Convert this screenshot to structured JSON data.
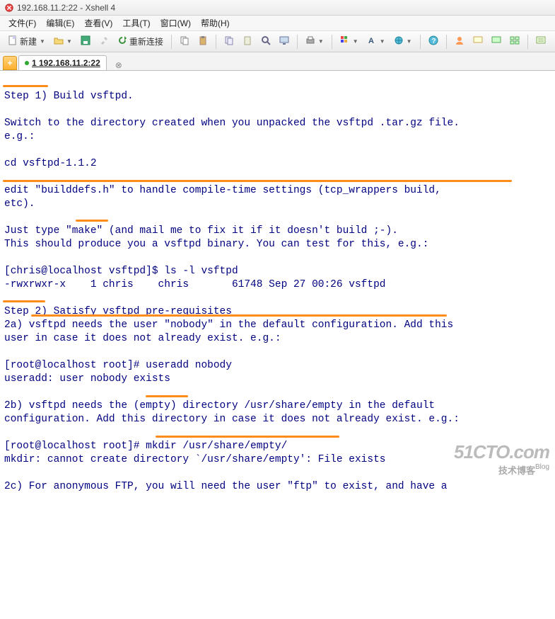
{
  "title": "192.168.11.2:22 - Xshell 4",
  "menu": {
    "file": "文件(F)",
    "edit": "编辑(E)",
    "view": "查看(V)",
    "tool": "工具(T)",
    "window": "窗口(W)",
    "help": "帮助(H)"
  },
  "toolbar": {
    "new_label": "新建",
    "reconnect_label": "重新连接"
  },
  "tab": {
    "label": "1 192.168.11.2:22"
  },
  "terminal": {
    "l01": "Step 1) Build vsftpd.",
    "l02": "",
    "l03": "Switch to the directory created when you unpacked the vsftpd .tar.gz file.",
    "l04": "e.g.:",
    "l05": "",
    "l06": "cd vsftpd-1.1.2",
    "l07": "",
    "l08": "edit \"builddefs.h\" to handle compile-time settings (tcp_wrappers build,",
    "l09": "etc).",
    "l10": "",
    "l11": "Just type \"make\" (and mail me to fix it if it doesn't build ;-).",
    "l12": "This should produce you a vsftpd binary. You can test for this, e.g.:",
    "l13": "",
    "l14": "[chris@localhost vsftpd]$ ls -l vsftpd",
    "l15": "-rwxrwxr-x    1 chris    chris       61748 Sep 27 00:26 vsftpd",
    "l16": "",
    "l17": "Step 2) Satisfy vsftpd pre-requisites",
    "l18": "2a) vsftpd needs the user \"nobody\" in the default configuration. Add this",
    "l19": "user in case it does not already exist. e.g.:",
    "l20": "",
    "l21": "[root@localhost root]# useradd nobody",
    "l22": "useradd: user nobody exists",
    "l23": "",
    "l24": "2b) vsftpd needs the (empty) directory /usr/share/empty in the default",
    "l25": "configuration. Add this directory in case it does not already exist. e.g.:",
    "l26": "",
    "l27": "[root@localhost root]# mkdir /usr/share/empty/",
    "l28": "mkdir: cannot create directory `/usr/share/empty': File exists",
    "l29": "",
    "l30": "2c) For anonymous FTP, you will need the user \"ftp\" to exist, and have a"
  },
  "watermark": {
    "line1": "51CTO.com",
    "line2": "技术博客",
    "line3": " Blog"
  },
  "icons": {
    "app": "app-icon",
    "new": "doc-new-icon",
    "open": "folder-open-icon",
    "save": "disk-icon",
    "tools": "tools-icon",
    "reconnect": "reconnect-icon",
    "copy": "copy-icon",
    "paste": "paste-icon",
    "search": "search-icon",
    "screen": "screen-icon",
    "print": "print-icon",
    "color": "palette-icon",
    "font": "font-icon",
    "globe": "globe-icon",
    "help": "help-icon",
    "user": "user-icon",
    "sess1": "session-icon",
    "sess2": "session-green-icon",
    "sess3": "session-grid-icon",
    "board": "board-icon",
    "plus": "plus-icon",
    "close": "close-icon",
    "dropdown": "chevron-down-icon"
  }
}
